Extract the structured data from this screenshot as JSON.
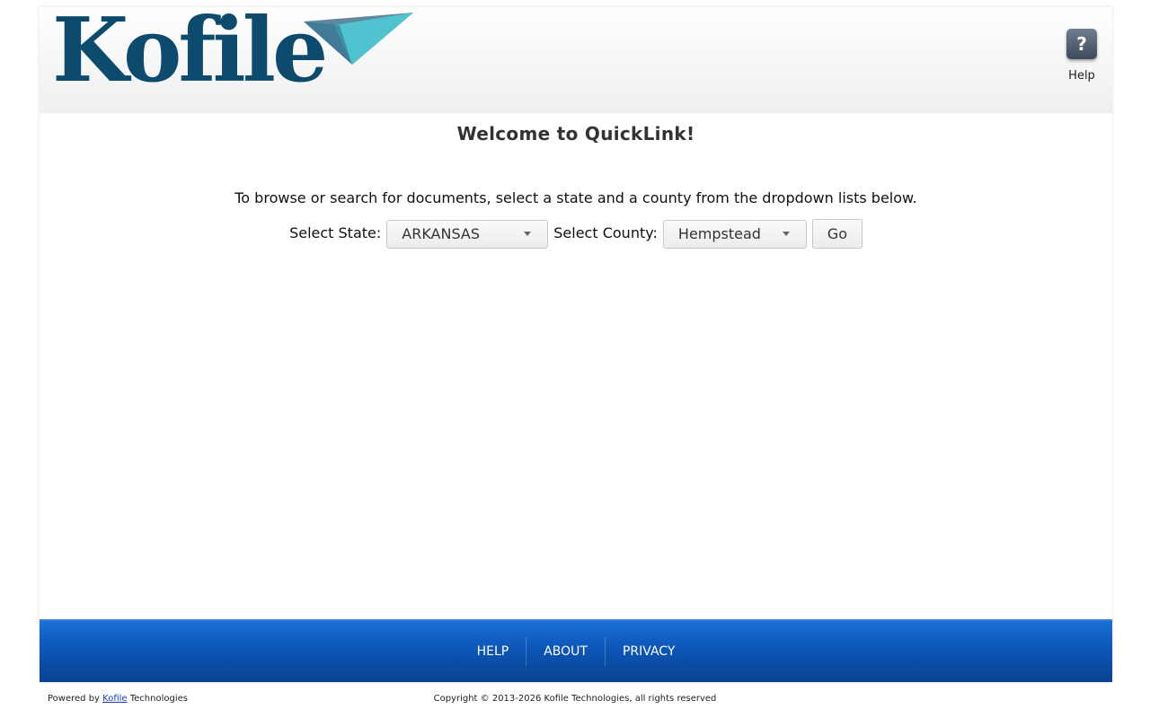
{
  "brand": {
    "logo_text": "Kofile",
    "logo_color": "#0d4b6e",
    "accent_color": "#4fc3cf"
  },
  "header": {
    "help_icon_glyph": "?",
    "help_label": "Help"
  },
  "main": {
    "title": "Welcome to QuickLink!",
    "instructions": "To browse or search for documents, select a state and a county from the dropdown lists below.",
    "state_label": "Select State:",
    "state_value": "ARKANSAS",
    "county_label": "Select County:",
    "county_value": "Hempstead",
    "go_label": "Go"
  },
  "footer": {
    "links": [
      "HELP",
      "ABOUT",
      "PRIVACY"
    ],
    "bar_color": "#0c56b8",
    "powered_prefix": "Powered by ",
    "powered_link": "Kofile",
    "powered_suffix": " Technologies",
    "copyright": "Copyright © 2013-2026 Kofile Technologies, all rights reserved"
  }
}
